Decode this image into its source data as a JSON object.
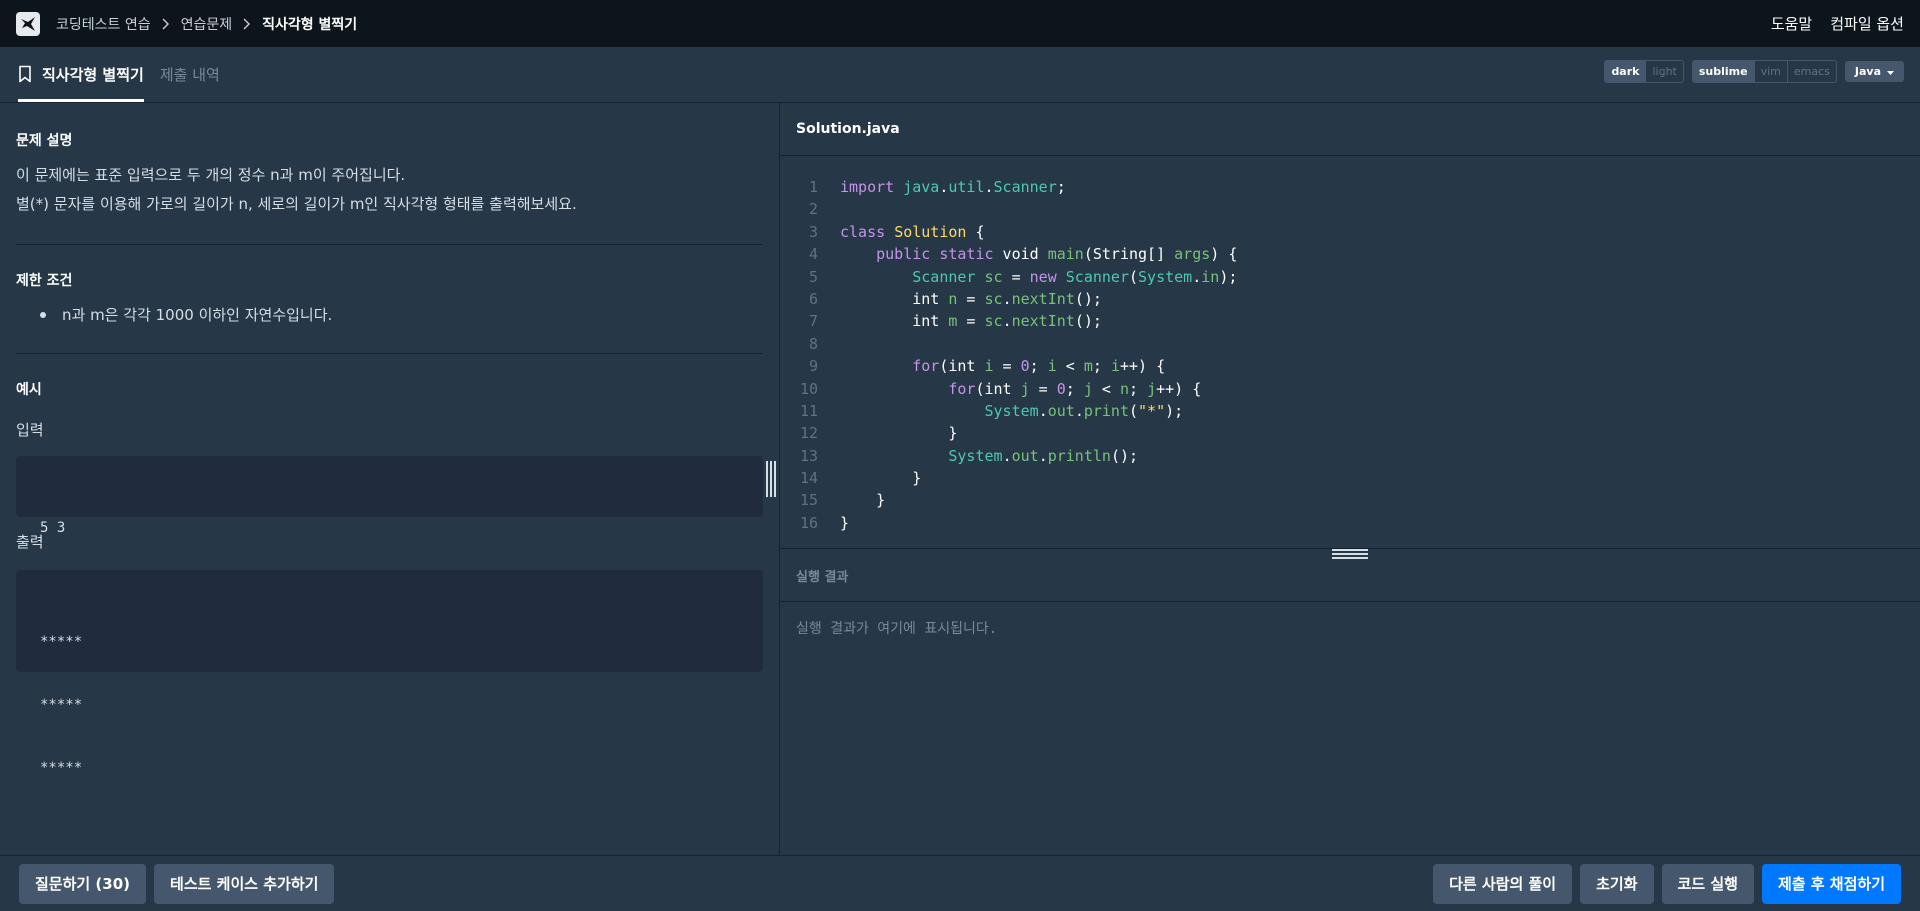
{
  "nav": {
    "breadcrumb": [
      "코딩테스트 연습",
      "연습문제",
      "직사각형 별찍기"
    ],
    "help": "도움말",
    "compile_options": "컴파일 옵션"
  },
  "tabs": {
    "problem": "직사각형 별찍기",
    "submissions": "제출 내역"
  },
  "editor_options": {
    "theme": [
      "dark",
      "light"
    ],
    "theme_selected": "dark",
    "keymap": [
      "sublime",
      "vim",
      "emacs"
    ],
    "keymap_selected": "sublime",
    "language": "Java"
  },
  "problem": {
    "desc_title": "문제 설명",
    "desc_lines": [
      "이 문제에는 표준 입력으로 두 개의 정수 n과 m이 주어집니다.",
      "별(*) 문자를 이용해 가로의 길이가 n, 세로의 길이가 m인 직사각형 형태를 출력해보세요."
    ],
    "constraint_title": "제한 조건",
    "constraints": [
      "n과 m은 각각 1000 이하인 자연수입니다."
    ],
    "example_title": "예시",
    "input_label": "입력",
    "input_value": "5 3",
    "output_label": "출력",
    "output_lines": [
      "*****",
      "*****",
      "*****"
    ]
  },
  "editor": {
    "filename": "Solution.java",
    "code_lines": [
      "import java.util.Scanner;",
      "",
      "class Solution {",
      "    public static void main(String[] args) {",
      "        Scanner sc = new Scanner(System.in);",
      "        int n = sc.nextInt();",
      "        int m = sc.nextInt();",
      "",
      "        for(int i = 0; i < m; i++) {",
      "            for(int j = 0; j < n; j++) {",
      "                System.out.print(\"*\");",
      "            }",
      "            System.out.println();",
      "        }",
      "    }",
      "}"
    ]
  },
  "result": {
    "title": "실행 결과",
    "placeholder": "실행 결과가 여기에 표시됩니다."
  },
  "bottom": {
    "ask": "질문하기 (30)",
    "add_testcase": "테스트 케이스 추가하기",
    "others": "다른 사람의 풀이",
    "reset": "초기화",
    "run": "코드 실행",
    "submit": "제출 후 채점하기"
  },
  "colors": {
    "background": "#263747",
    "topbar": "#0c151c",
    "primary_button": "#0078ff",
    "secondary_button": "#44576c"
  }
}
